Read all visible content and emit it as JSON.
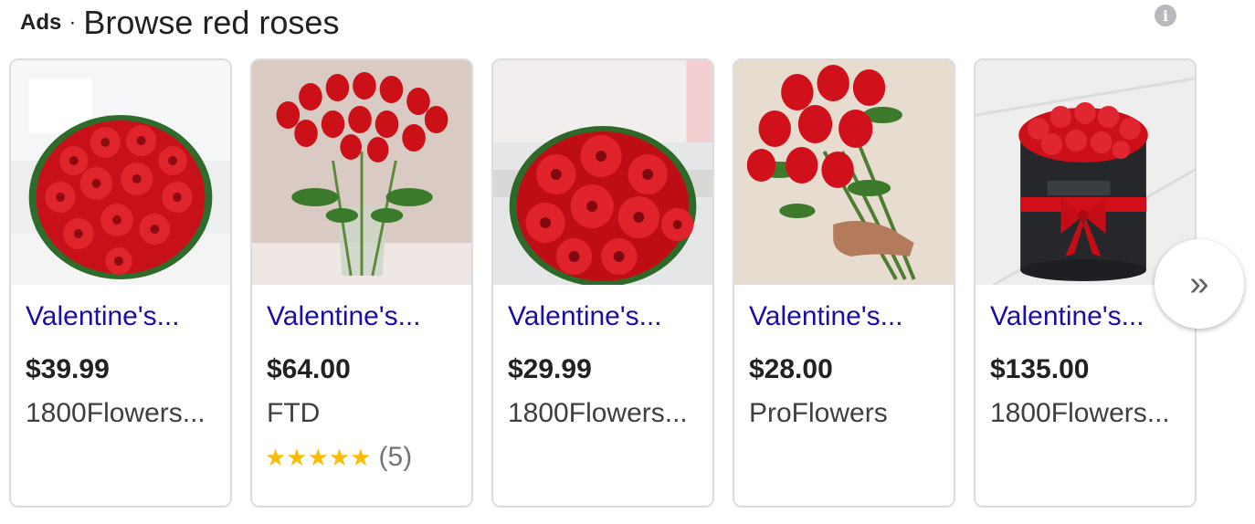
{
  "header": {
    "ads_label": "Ads",
    "separator": "·",
    "title": "Browse red roses",
    "info_icon": "i"
  },
  "products": [
    {
      "name": "Valentine's...",
      "price": "$39.99",
      "seller": "1800Flowers..."
    },
    {
      "name": "Valentine's...",
      "price": "$64.00",
      "seller": "FTD",
      "stars": "★★★★★",
      "review_count": "(5)"
    },
    {
      "name": "Valentine's...",
      "price": "$29.99",
      "seller": "1800Flowers..."
    },
    {
      "name": "Valentine's...",
      "price": "$28.00",
      "seller": "ProFlowers"
    },
    {
      "name": "Valentine's...",
      "price": "$135.00",
      "seller": "1800Flowers..."
    }
  ],
  "next_button": {
    "icon": "»"
  },
  "colors": {
    "link": "#1a0dab",
    "star": "#fbbc04",
    "rose": "#d0101a"
  }
}
